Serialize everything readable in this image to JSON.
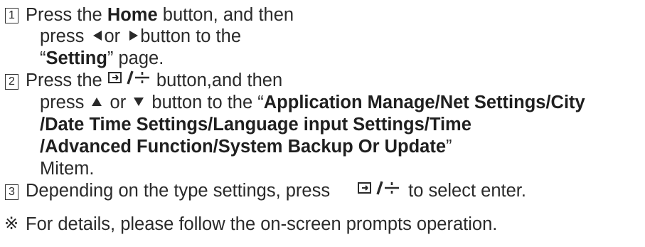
{
  "steps": [
    {
      "number": "1",
      "line1_a": "Press the ",
      "line1_bold": "Home",
      "line1_b": " button, and then",
      "line2_a": "press ",
      "line2_b": "or ",
      "line2_c": "button to the",
      "line3_open": "“",
      "line3_bold": "Setting",
      "line3_rest": "” page."
    },
    {
      "number": "2",
      "line1_a": "Press the ",
      "line1_b": " button,and then",
      "line2_a": "press ",
      "line2_b": " or ",
      "line2_c": " button to the “",
      "line2_bold": "Application Manage/Net Settings/City",
      "line3_bold": "/Date Time Settings/Language input Settings/Time",
      "line4_bold": "/Advanced Function/System Backup Or Update",
      "line4_close": "”",
      "line5": "Mitem."
    },
    {
      "number": "3",
      "line1_a": "Depending on the type settings, press",
      "line1_b": "to select enter."
    }
  ],
  "note": {
    "mark": "※",
    "text": "For details, please follow the on-screen prompts operation."
  },
  "icons": {
    "left": "left-triangle-icon",
    "right": "right-triangle-icon",
    "up": "up-triangle-icon",
    "down": "down-triangle-icon",
    "enter": "enter-plus-icon"
  }
}
